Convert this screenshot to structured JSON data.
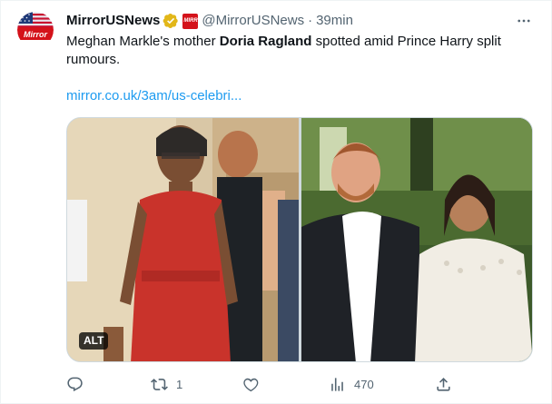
{
  "account": {
    "display_name": "MirrorUSNews",
    "handle": "@MirrorUSNews",
    "separator": "·",
    "time": "39min",
    "avatar_text": "Mirror",
    "affiliate_badge_text": "MIRR OR"
  },
  "tweet": {
    "text_before": "Meghan Markle's mother ",
    "text_bold": "Doria Ragland",
    "text_after": " spotted amid Prince Harry split rumours.",
    "link": "mirror.co.uk/3am/us-celebri..."
  },
  "media": {
    "alt_label": "ALT",
    "image_count": 2
  },
  "actions": {
    "reply_count": "",
    "retweet_count": "1",
    "like_count": "",
    "views_count": "470"
  },
  "colors": {
    "text_primary": "#0f1419",
    "text_secondary": "#536471",
    "link": "#1d9bf0",
    "verified_gold": "#e2b719",
    "brand_red": "#d4121a"
  },
  "icons": {
    "verified": "verified-gold-badge-icon",
    "more": "more-horizontal-icon",
    "reply": "reply-icon",
    "retweet": "retweet-icon",
    "like": "heart-icon",
    "views": "views-bar-chart-icon",
    "share": "share-upload-icon"
  }
}
